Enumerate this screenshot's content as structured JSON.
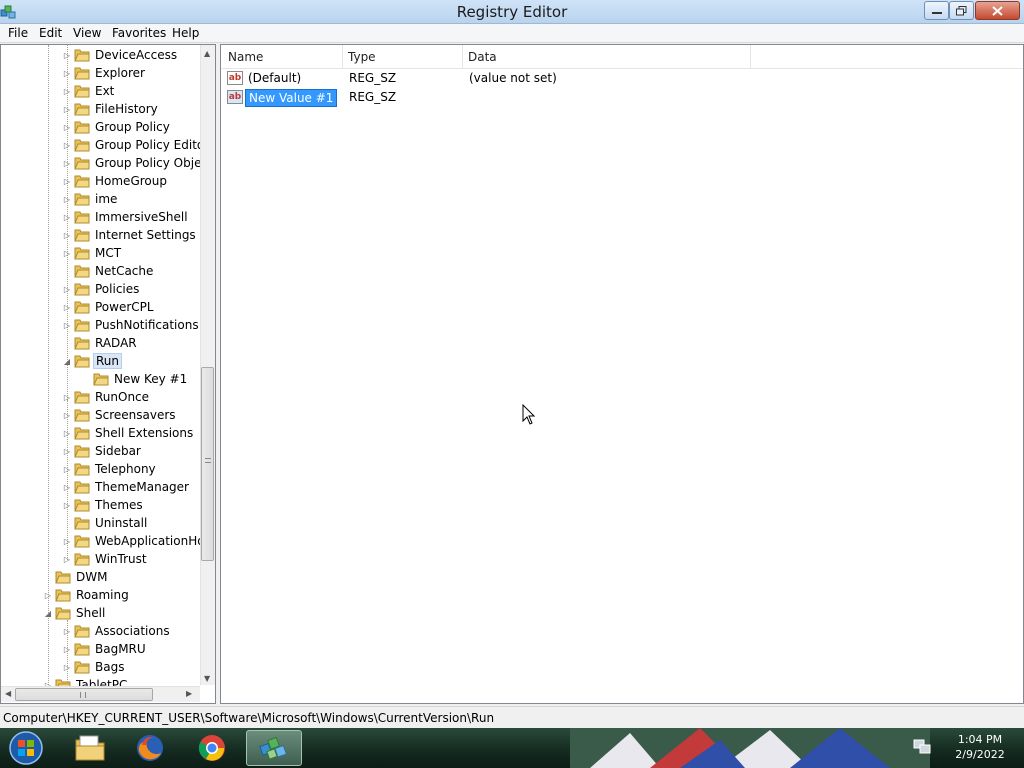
{
  "window": {
    "title": "Registry Editor"
  },
  "menu": [
    "File",
    "Edit",
    "View",
    "Favorites",
    "Help"
  ],
  "tree": {
    "items": [
      {
        "label": "DeviceAccess",
        "expander": "▷"
      },
      {
        "label": "Explorer",
        "expander": "▷"
      },
      {
        "label": "Ext",
        "expander": "▷"
      },
      {
        "label": "FileHistory",
        "expander": "▷"
      },
      {
        "label": "Group Policy",
        "expander": "▷"
      },
      {
        "label": "Group Policy Editor",
        "expander": "▷"
      },
      {
        "label": "Group Policy Objec",
        "expander": "▷"
      },
      {
        "label": "HomeGroup",
        "expander": "▷"
      },
      {
        "label": "ime",
        "expander": "▷"
      },
      {
        "label": "ImmersiveShell",
        "expander": "▷"
      },
      {
        "label": "Internet Settings",
        "expander": "▷"
      },
      {
        "label": "MCT",
        "expander": "▷"
      },
      {
        "label": "NetCache",
        "expander": ""
      },
      {
        "label": "Policies",
        "expander": "▷"
      },
      {
        "label": "PowerCPL",
        "expander": "▷"
      },
      {
        "label": "PushNotifications",
        "expander": "▷"
      },
      {
        "label": "RADAR",
        "expander": ""
      },
      {
        "label": "Run",
        "expander": "◢"
      },
      {
        "label": "New Key #1",
        "expander": ""
      },
      {
        "label": "RunOnce",
        "expander": "▷"
      },
      {
        "label": "Screensavers",
        "expander": "▷"
      },
      {
        "label": "Shell Extensions",
        "expander": "▷"
      },
      {
        "label": "Sidebar",
        "expander": "▷"
      },
      {
        "label": "Telephony",
        "expander": "▷"
      },
      {
        "label": "ThemeManager",
        "expander": "▷"
      },
      {
        "label": "Themes",
        "expander": "▷"
      },
      {
        "label": "Uninstall",
        "expander": ""
      },
      {
        "label": "WebApplicationHo",
        "expander": "▷"
      },
      {
        "label": "WinTrust",
        "expander": "▷"
      },
      {
        "label": "DWM",
        "expander": ""
      },
      {
        "label": "Roaming",
        "expander": "▷"
      },
      {
        "label": "Shell",
        "expander": "◢"
      },
      {
        "label": "Associations",
        "expander": "▷"
      },
      {
        "label": "BagMRU",
        "expander": "▷"
      },
      {
        "label": "Bags",
        "expander": "▷"
      },
      {
        "label": "TabletPC",
        "expander": "▷"
      }
    ],
    "selected": "Run"
  },
  "values": {
    "columns": [
      "Name",
      "Type",
      "Data"
    ],
    "rows": [
      {
        "name": "(Default)",
        "type": "REG_SZ",
        "data": "(value not set)"
      },
      {
        "name": "New Value #1",
        "type": "REG_SZ",
        "data": ""
      }
    ],
    "editing_row": "New Value #1"
  },
  "status": {
    "path": "Computer\\HKEY_CURRENT_USER\\Software\\Microsoft\\Windows\\CurrentVersion\\Run"
  },
  "taskbar": {
    "time": "1:04 PM",
    "date": "2/9/2022",
    "apps": [
      "file-explorer-icon",
      "firefox-icon",
      "chrome-icon",
      "registry-editor-icon"
    ],
    "active_app": "registry-editor-icon"
  },
  "colors": {
    "selection": "#3399ff",
    "folder": "#e8c25a",
    "titlebar": "#b9d3ee"
  }
}
